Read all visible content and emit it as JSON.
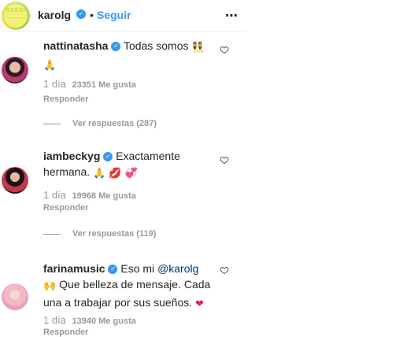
{
  "header": {
    "username": "karolg",
    "avatar_text": "OCEAN",
    "separator": "•",
    "follow_label": "Seguir",
    "more_icon": "⋯"
  },
  "comments": [
    {
      "username": "nattinatasha",
      "text": "Todas somos",
      "emojis_inline": "👯",
      "emojis_line2": "🙏",
      "time": "1 día",
      "likes": "23351 Me gusta",
      "reply_label": "Responder",
      "view_replies": "Ver respuestas (287)"
    },
    {
      "username": "iambeckyg",
      "text": "Exactamente",
      "line2": "hermana.",
      "emojis_line2": "🙏 💋 💞",
      "time": "1 día",
      "likes": "19968 Me gusta",
      "reply_label": "Responder",
      "view_replies": "Ver respuestas (119)"
    },
    {
      "username": "farinamusic",
      "text": "Eso mi",
      "mention": "@karolg",
      "line2": "Que belleza de mensaje. Cada",
      "line2_emoji": "🙌",
      "line3": "una a trabajar por sus sueños.",
      "line3_emoji": "❤",
      "time": "1 día",
      "likes": "13940 Me gusta",
      "reply_label": "Responder"
    }
  ],
  "colors": {
    "link": "#3897f0",
    "muted": "#999999",
    "text": "#262626",
    "verified": "#3897f0"
  }
}
